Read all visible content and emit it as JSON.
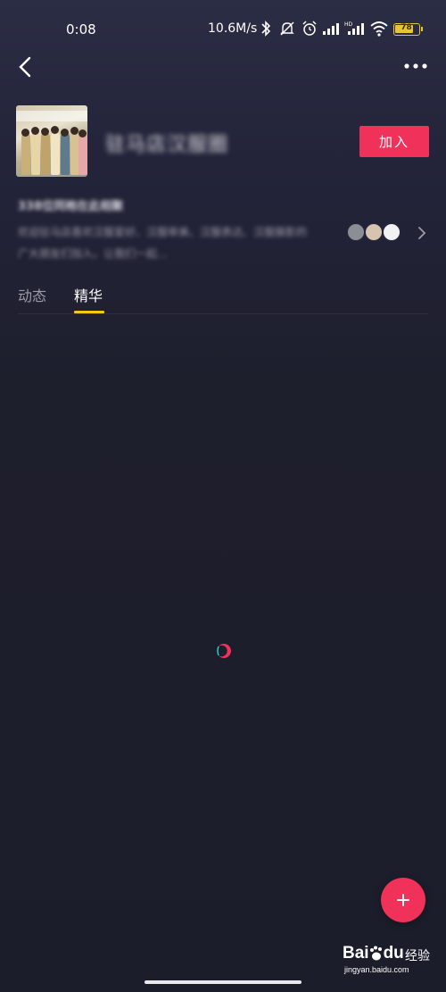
{
  "status_bar": {
    "time": "0:08",
    "network_speed": "10.6M/s",
    "battery_level": "78",
    "battery_fraction": 0.78,
    "icons": [
      "bluetooth-icon",
      "mute-icon",
      "alarm-icon",
      "signal-icon",
      "signal-hd-icon",
      "wifi-icon",
      "battery-icon"
    ]
  },
  "header": {
    "back_icon": "chevron-left-icon",
    "more_icon": "more-dots-icon"
  },
  "group": {
    "name": "驻马店汉服圈",
    "join_label": "加入",
    "description_title": "338位同袍在此相聚",
    "description_text": "欢迎驻马店喜欢汉服爱好、汉服审美、汉服表达、汉服摄影的广大朋友们加入，让我们一起…"
  },
  "tabs": [
    {
      "label": "动态",
      "active": false
    },
    {
      "label": "精华",
      "active": true
    }
  ],
  "fab": {
    "icon": "plus-icon"
  },
  "watermark": {
    "logo_prefix": "Bai",
    "logo_suffix": "du",
    "product": "经验",
    "url": "jingyan.baidu.com"
  },
  "colors": {
    "accent": "#f0315a",
    "tab_indicator": "#f3c912",
    "background": "#1e1f2d"
  }
}
